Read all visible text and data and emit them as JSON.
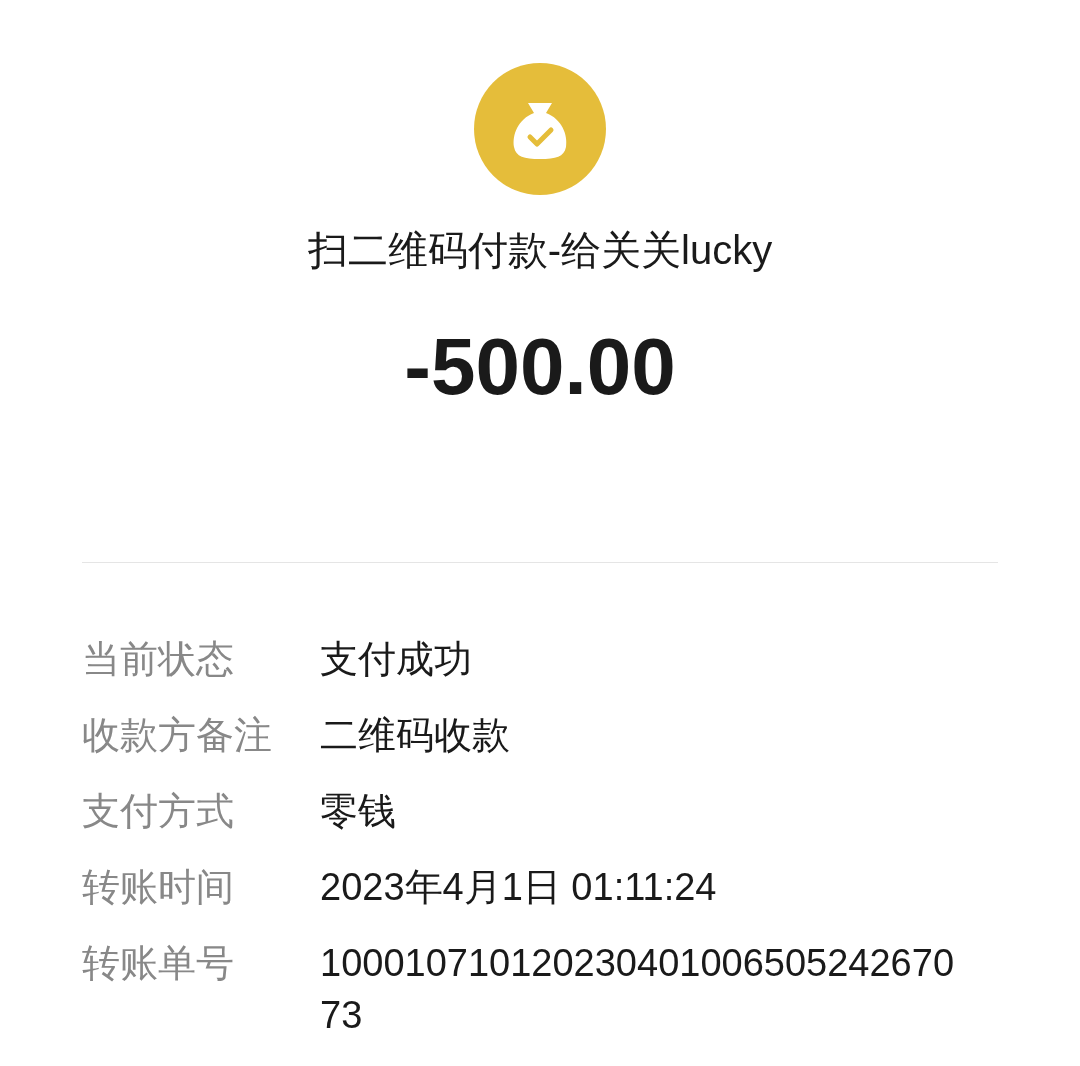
{
  "title": "扫二维码付款-给关关lucky",
  "amount": "-500.00",
  "details": [
    {
      "label": "当前状态",
      "value": "支付成功"
    },
    {
      "label": "收款方备注",
      "value": "二维码收款"
    },
    {
      "label": "支付方式",
      "value": "零钱"
    },
    {
      "label": "转账时间",
      "value": "2023年4月1日 01:11:24"
    },
    {
      "label": "转账单号",
      "value": "10001071012023040100650524267073"
    }
  ]
}
